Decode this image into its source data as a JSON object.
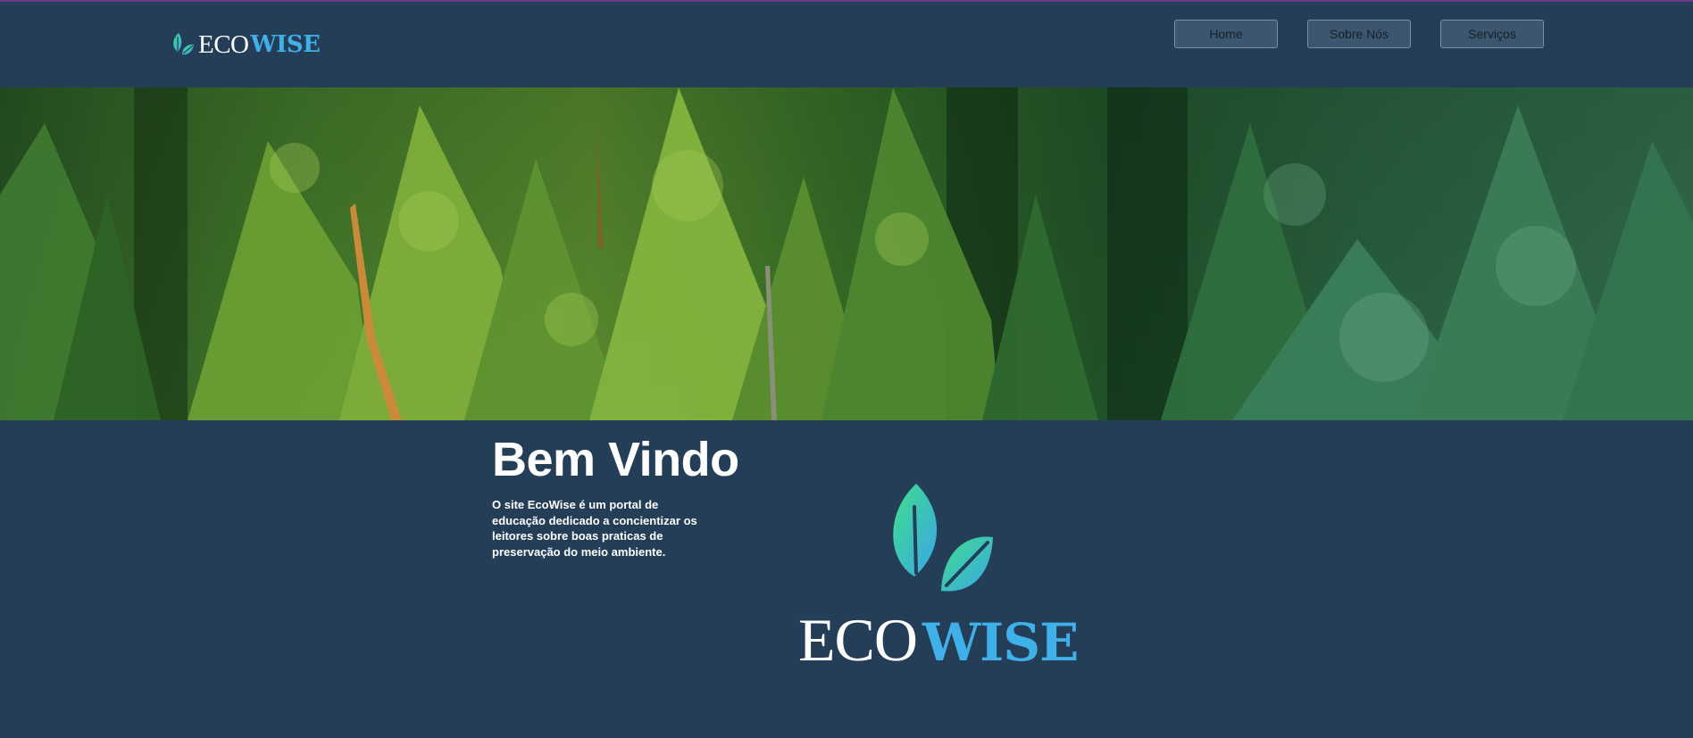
{
  "header": {
    "logo": {
      "icon": "leaf-icon",
      "eco": "ECO",
      "wise": "WISE"
    },
    "nav": [
      {
        "label": "Home"
      },
      {
        "label": "Sobre Nós"
      },
      {
        "label": "Serviços"
      }
    ]
  },
  "hero": {
    "image": "forest-treetops-photo"
  },
  "main": {
    "title": "Bem Vindo",
    "description": "O site EcoWise é um portal de educação dedicado a concientizar os leitores sobre boas praticas de preservação do meio ambiente.",
    "logo": {
      "icon": "leaf-icon",
      "eco": "ECO",
      "wise": "WISE"
    }
  },
  "colors": {
    "background": "#243e58",
    "accent_top": "#6a3a8c",
    "brand_blue": "#3fb0e8",
    "leaf_green": "#3dd89a",
    "button_bg": "#3d5670"
  }
}
